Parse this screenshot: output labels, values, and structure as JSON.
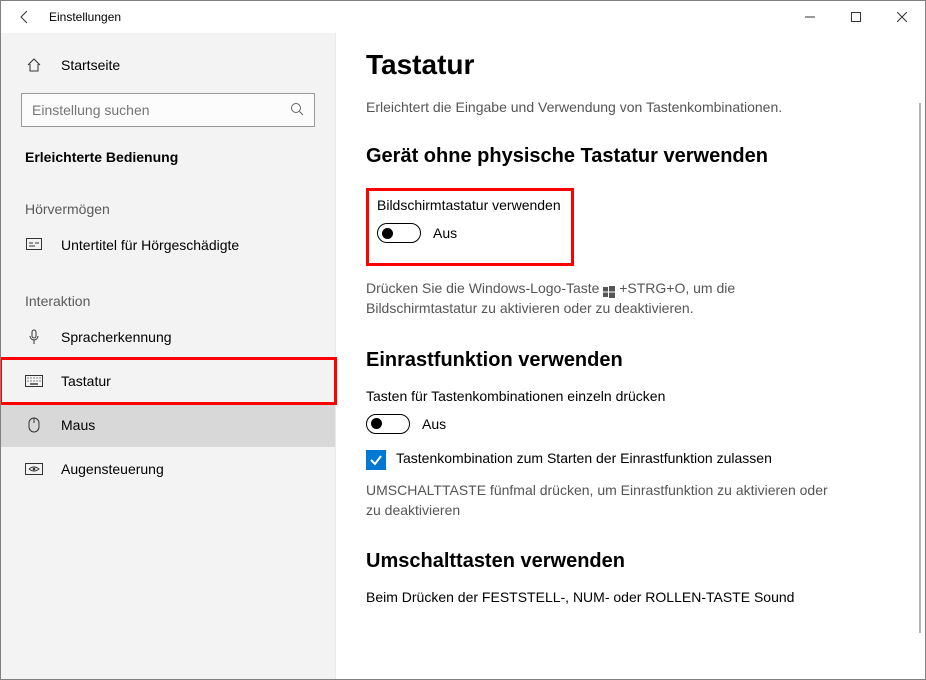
{
  "window": {
    "title": "Einstellungen"
  },
  "sidebar": {
    "home": "Startseite",
    "search_placeholder": "Einstellung suchen",
    "category": "Erleichterte Bedienung",
    "group_hearing": "Hörvermögen",
    "item_subtitles": "Untertitel für Hörgeschädigte",
    "group_interaction": "Interaktion",
    "item_speech": "Spracherkennung",
    "item_keyboard": "Tastatur",
    "item_mouse": "Maus",
    "item_eyecontrol": "Augensteuerung"
  },
  "main": {
    "title": "Tastatur",
    "subtitle": "Erleichtert die Eingabe und Verwendung von Tastenkombinationen.",
    "section_osk": {
      "heading": "Gerät ohne physische Tastatur verwenden",
      "label": "Bildschirmtastatur verwenden",
      "state": "Aus",
      "hint_pre": "Drücken Sie die Windows-Logo-Taste",
      "hint_post": "+STRG+O, um die Bildschirmtastatur zu aktivieren oder zu deaktivieren."
    },
    "section_sticky": {
      "heading": "Einrastfunktion verwenden",
      "label": "Tasten für Tastenkombinationen einzeln drücken",
      "state": "Aus",
      "checkbox_label": "Tastenkombination zum Starten der Einrastfunktion zulassen",
      "hint": "UMSCHALTTASTE fünfmal drücken, um Einrastfunktion zu aktivieren oder zu deaktivieren"
    },
    "section_toggle": {
      "heading": "Umschalttasten verwenden",
      "label": "Beim Drücken der FESTSTELL-, NUM- oder ROLLEN-TASTE Sound"
    }
  }
}
